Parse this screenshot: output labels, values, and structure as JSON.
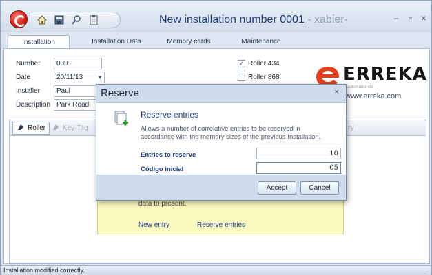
{
  "window": {
    "title": "New installation number 0001",
    "title_suffix": " - xabier-",
    "minimize_symbol": "–",
    "maximize_symbol": "▫",
    "close_symbol": "×"
  },
  "tabs": [
    {
      "label": "Installation",
      "active": true
    },
    {
      "label": "Installation Data",
      "active": false
    },
    {
      "label": "Memory cards",
      "active": false
    },
    {
      "label": "Maintenance",
      "active": false
    }
  ],
  "form": {
    "number_label": "Number",
    "number_value": "0001",
    "date_label": "Date",
    "date_value": "20/11/13",
    "installer_label": "Installer",
    "installer_value": "Paul",
    "description_label": "Description",
    "description_value": "Park Road"
  },
  "options": [
    {
      "label": "Roller 434",
      "checked": true
    },
    {
      "label": "Roller 868",
      "checked": false
    }
  ],
  "brand": {
    "name": "ERREKA",
    "tagline": "automatismos",
    "website": "www.erreka.com",
    "accent_color": "#e2401f"
  },
  "toolbar": {
    "roller_label": "Roller",
    "keytag_label": "Key-Tag",
    "hidden_fragment": "ry"
  },
  "hint": {
    "text": "data to present.",
    "new_entry_label": "New entry",
    "reserve_entries_label": "Reserve entries",
    "background": "#fdfbc1"
  },
  "status": {
    "message": "Installation modified correctly."
  },
  "dialog": {
    "title": "Reserve",
    "close_symbol": "×",
    "heading": "Reserve entries",
    "description": "Allows a number of correlative entries to be reserved in accordance with the memory sizes of the previous Installation.",
    "entries_label": "Entries to reserve",
    "entries_value": "10",
    "code_label": "Código inicial",
    "code_value": "05",
    "accept_label": "Accept",
    "cancel_label": "Cancel"
  }
}
